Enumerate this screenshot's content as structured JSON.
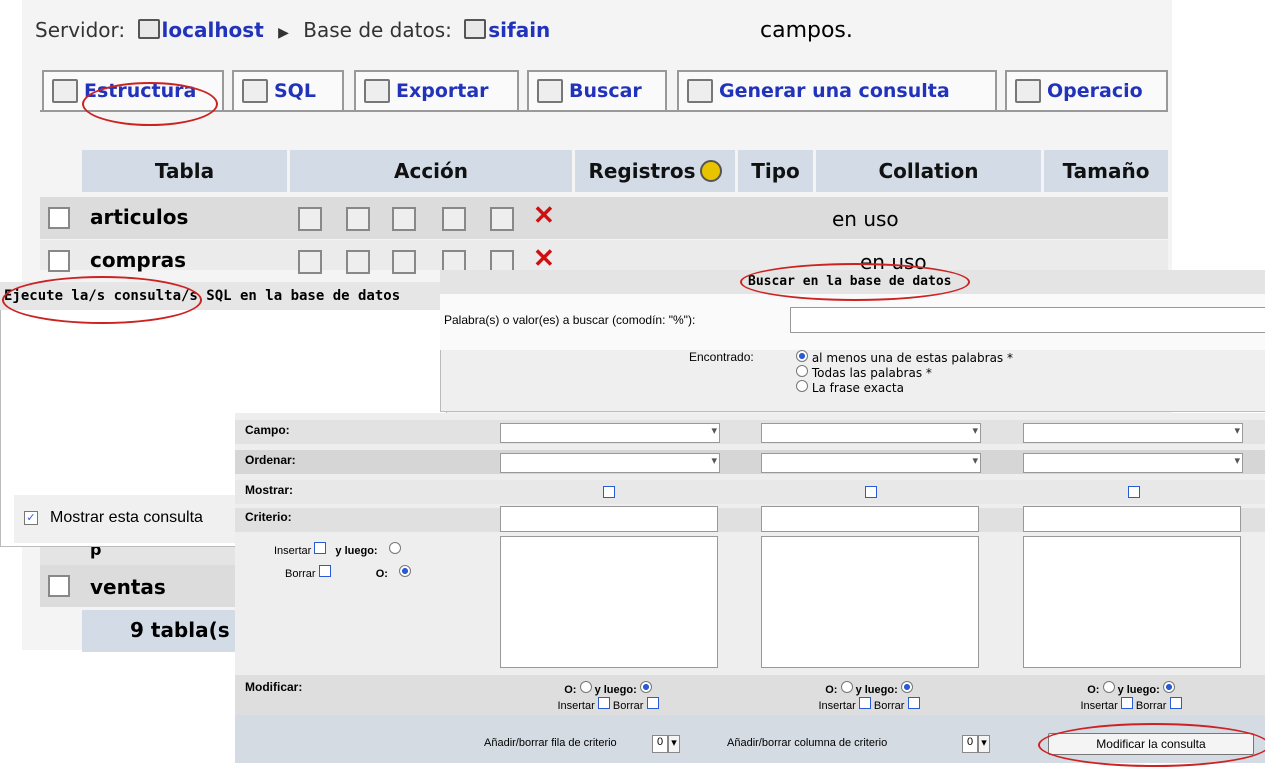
{
  "breadcrumb": {
    "server_label": "Servidor:",
    "server": "localhost",
    "db_label": "Base de datos:",
    "db": "sifain"
  },
  "note": "campos.",
  "tabs": [
    {
      "label": "Estructura",
      "icon": "structure-icon"
    },
    {
      "label": "SQL",
      "icon": "sql-icon"
    },
    {
      "label": "Exportar",
      "icon": "export-icon"
    },
    {
      "label": "Buscar",
      "icon": "search-icon"
    },
    {
      "label": "Generar una consulta",
      "icon": "query-icon"
    },
    {
      "label": "Operacio",
      "icon": "operations-icon"
    }
  ],
  "table": {
    "headers": {
      "tabla": "Tabla",
      "accion": "Acción",
      "registros": "Registros",
      "tipo": "Tipo",
      "collation": "Collation",
      "tamano": "Tamaño"
    },
    "rows": [
      {
        "name": "articulos",
        "status": "en uso"
      },
      {
        "name": "compras",
        "status": "en uso"
      },
      {
        "name": "ventas"
      }
    ],
    "partial_row": "p",
    "summary": "9 tabla(s"
  },
  "sql_panel": {
    "title": "Ejecute la/s consulta/s SQL en la base de datos",
    "show_query_label": "Mostrar esta consulta"
  },
  "search_panel": {
    "title": "Buscar en la base de datos",
    "words_label": "Palabra(s) o valor(es) a buscar (comodín: \"%\"):",
    "found_label": "Encontrado:",
    "options": [
      "al menos una de estas palabras *",
      "Todas las palabras *",
      "La frase exacta"
    ]
  },
  "qbe": {
    "labels": {
      "campo": "Campo:",
      "ordenar": "Ordenar:",
      "mostrar": "Mostrar:",
      "criterio": "Criterio:",
      "modificar": "Modificar:"
    },
    "ins_label": "Insertar",
    "del_label": "Borrar",
    "then_label": "y luego:",
    "or_label": "O:",
    "col_mod": {
      "or": "O:",
      "then": "y luego:",
      "ins": "Insertar",
      "del": "Borrar"
    },
    "add_row_label": "Añadir/borrar fila de criterio",
    "add_col_label": "Añadir/borrar columna de criterio",
    "row_count": "0",
    "col_count": "0",
    "submit": "Modificar la consulta"
  },
  "colors": {
    "accent": "#2233bb",
    "annotation": "#cc2222",
    "header_bg": "#d3dce6"
  }
}
